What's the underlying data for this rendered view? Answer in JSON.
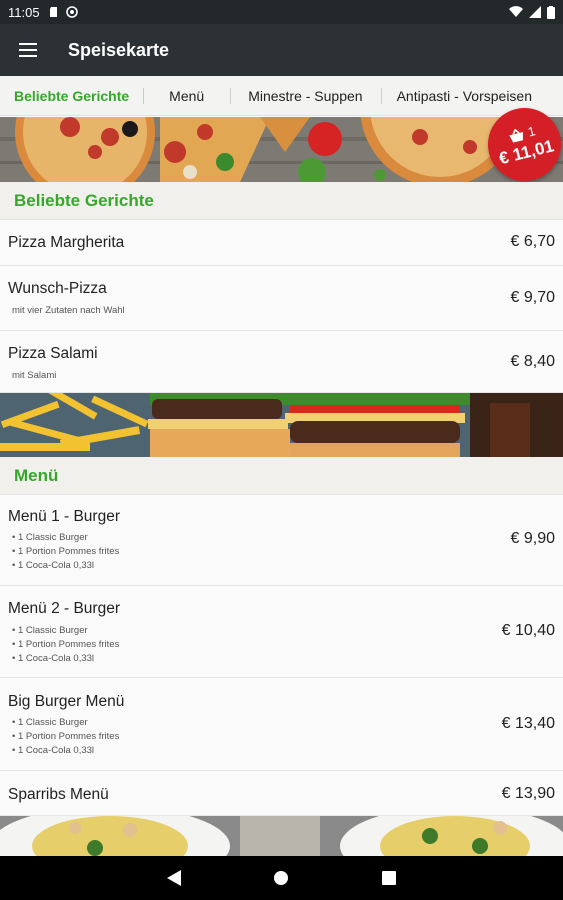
{
  "status": {
    "time": "11:05"
  },
  "appbar": {
    "title": "Speisekarte"
  },
  "tabs": [
    "Beliebte Gerichte",
    "Menü",
    "Minestre - Suppen",
    "Antipasti - Vorspeisen"
  ],
  "cart": {
    "count": "1",
    "total": "€ 11,01"
  },
  "sections": [
    {
      "title": "Beliebte Gerichte",
      "items": [
        {
          "name": "Pizza Margherita",
          "price": "€ 6,70"
        },
        {
          "name": "Wunsch-Pizza",
          "desc": "mit vier Zutaten nach Wahl",
          "price": "€ 9,70"
        },
        {
          "name": "Pizza Salami",
          "desc": "mit Salami",
          "price": "€ 8,40"
        }
      ]
    },
    {
      "title": "Menü",
      "items": [
        {
          "name": "Menü 1 - Burger",
          "desc1": "• 1 Classic Burger",
          "desc2": "• 1 Portion Pommes frites",
          "desc3": "• 1 Coca-Cola 0,33l",
          "price": "€ 9,90"
        },
        {
          "name": "Menü 2 - Burger",
          "desc1": "• 1 Classic Burger",
          "desc2": "• 1 Portion Pommes frites",
          "desc3": "• 1 Coca-Cola 0,33l",
          "price": "€ 10,40"
        },
        {
          "name": "Big Burger Menü",
          "desc1": "• 1 Classic Burger",
          "desc2": "• 1 Portion Pommes frites",
          "desc3": "• 1 Coca-Cola 0,33l",
          "price": "€ 13,40"
        },
        {
          "name": "Sparribs Menü",
          "price": "€ 13,90"
        }
      ]
    }
  ],
  "colors": {
    "accent": "#35a82b",
    "cart": "#d51f26",
    "appbar": "#2b3134"
  }
}
